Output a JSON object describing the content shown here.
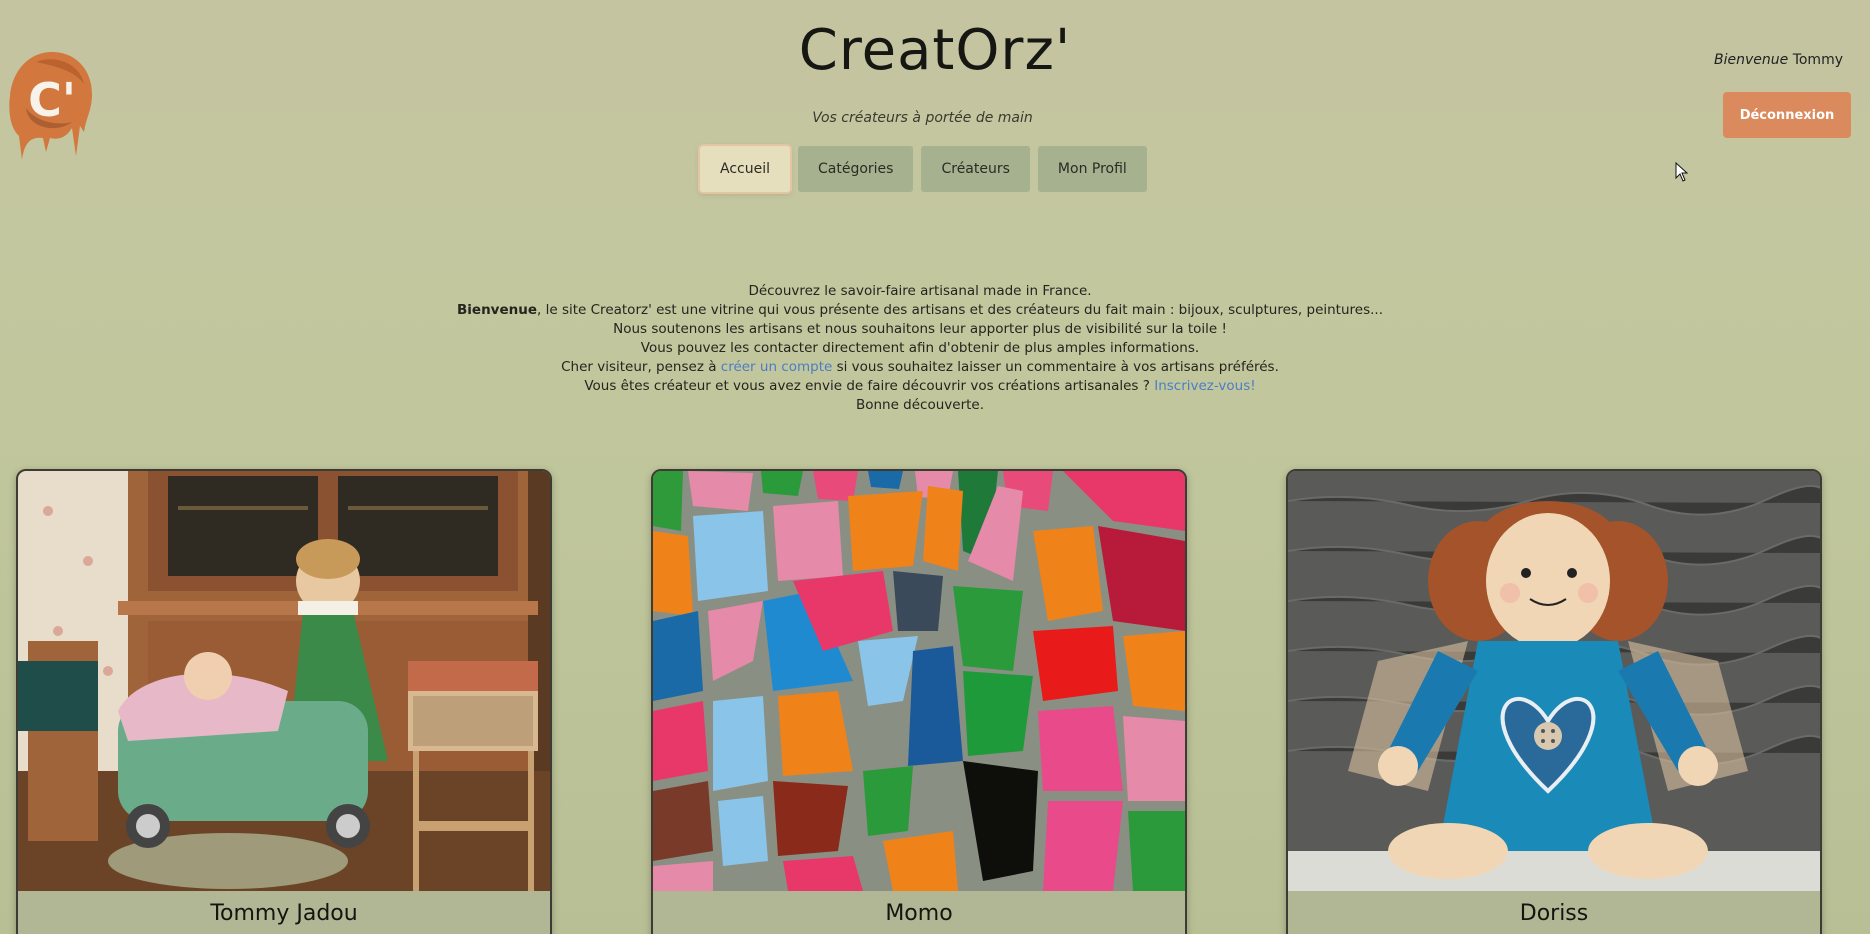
{
  "header": {
    "title": "CreatOrz'",
    "tagline": "Vos créateurs à portée de main",
    "logo_letter": "C'",
    "welcome_label": "Bienvenue",
    "username": "Tommy",
    "logout_label": "Déconnexion"
  },
  "nav": {
    "items": [
      {
        "label": "Accueil",
        "active": true
      },
      {
        "label": "Catégories",
        "active": false
      },
      {
        "label": "Créateurs",
        "active": false
      },
      {
        "label": "Mon Profil",
        "active": false
      }
    ]
  },
  "intro": {
    "line1": "Découvrez le savoir-faire artisanal made in France.",
    "line2_bold": "Bienvenue",
    "line2_rest": ", le site Creatorz' est une vitrine qui vous présente des artisans et des créateurs du fait main : bijoux, sculptures, peintures...",
    "line3": "Nous soutenons les artisans et nous souhaitons leur apporter plus de visibilité sur la toile !",
    "line4": "Vous pouvez les contacter directement afin d'obtenir de plus amples informations.",
    "line5_before": "Cher visiteur, pensez à ",
    "line5_link": "créer un compte",
    "line5_after": " si vous souhaitez laisser un commentaire à vos artisans préférés.",
    "line6_before": "Vous êtes créateur et vous avez envie de faire découvrir vos créations artisanales ? ",
    "line6_link": "Inscrivez-vous!",
    "line7": "Bonne découverte."
  },
  "creators": [
    {
      "name": "Tommy Jadou",
      "image": "dollhouse-photo"
    },
    {
      "name": "Momo",
      "image": "mosaic-photo"
    },
    {
      "name": "Doriss",
      "image": "rag-doll-photo"
    }
  ],
  "colors": {
    "accent": "#db8a5d",
    "nav": "#a5b18f",
    "nav_active": "#e6dfbd",
    "link": "#4c7dc4"
  }
}
